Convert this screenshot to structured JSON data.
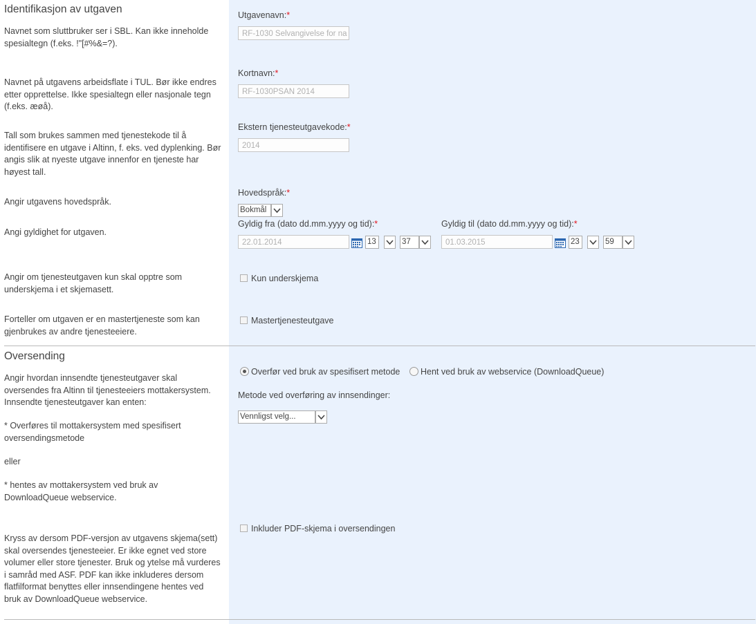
{
  "identification": {
    "title": "Identifikasjon av utgaven",
    "name_desc": "Navnet som sluttbruker ser i SBL. Kan ikke inneholde spesialtegn (f.eks. !\"[#%&=?).",
    "shortname_desc": "Navnet på utgavens arbeidsflate i TUL. Bør ikke endres etter opprettelse. Ikke spesialtegn eller nasjonale tegn (f.eks. æøå).",
    "code_desc": "Tall som brukes sammen med tjenestekode til å identifisere en utgave i Altinn, f. eks. ved dyplenking. Bør angis slik at nyeste utgave innenfor en tjeneste har høyest tall.",
    "language_desc": "Angir utgavens hovedspråk.",
    "validity_desc": "Angi gyldighet for utgaven.",
    "subform_desc": "Angir om tjenesteutgaven kun skal opptre som underskjema i et skjemasett.",
    "master_desc": "Forteller om utgaven er en mastertjeneste som kan gjenbrukes av andre tjenesteeiere.",
    "name_label": "Utgavenavn:",
    "name_value": "RF-1030 Selvangivelse for na",
    "shortname_label": "Kortnavn:",
    "shortname_value": "RF-1030PSAN 2014",
    "code_label": "Ekstern tjenesteutgavekode:",
    "code_value": "2014",
    "language_label": "Hovedspråk:",
    "language_value": "Bokmål",
    "valid_from_label": "Gyldig fra (dato dd.mm.yyyy og tid):",
    "valid_from_date": "22.01.2014",
    "valid_from_hour": "13",
    "valid_from_min": "37",
    "valid_to_label": "Gyldig til (dato dd.mm.yyyy og tid):",
    "valid_to_date": "01.03.2015",
    "valid_to_hour": "23",
    "valid_to_min": "59",
    "subform_label": "Kun underskjema",
    "master_label": "Mastertjenesteutgave",
    "required_mark": "*"
  },
  "transmission": {
    "title": "Oversending",
    "desc1": "Angir hvordan innsendte tjenesteutgaver skal oversendes fra Altinn til tjenesteeiers mottakersystem. Innsendte tjenesteutgaver kan enten:",
    "desc2": "* Overføres til mottakersystem med spesifisert oversendingsmetode",
    "desc3": "eller",
    "desc4": "* hentes av mottakersystem ved bruk av DownloadQueue webservice.",
    "pdf_desc": "Kryss av dersom PDF-versjon av utgavens skjema(sett) skal oversendes tjenesteeier. Er ikke egnet ved store volumer eller store tjenester. Bruk og ytelse må vurderes i samråd med ASF. PDF kan ikke inkluderes dersom flatfilformat benyttes eller innsendingene hentes ved bruk av DownloadQueue webservice.",
    "radio_method_label": "Overfør ved bruk av spesifisert metode",
    "radio_download_label": "Hent ved bruk av webservice (DownloadQueue)",
    "method_label": "Metode ved overføring av innsendinger:",
    "method_value": "Vennligst velg...",
    "pdf_label": "Inkluder PDF-skjema i oversendingen"
  },
  "icons": {
    "calendar": "calendar-icon",
    "dropdown": "chevron-down-icon"
  }
}
